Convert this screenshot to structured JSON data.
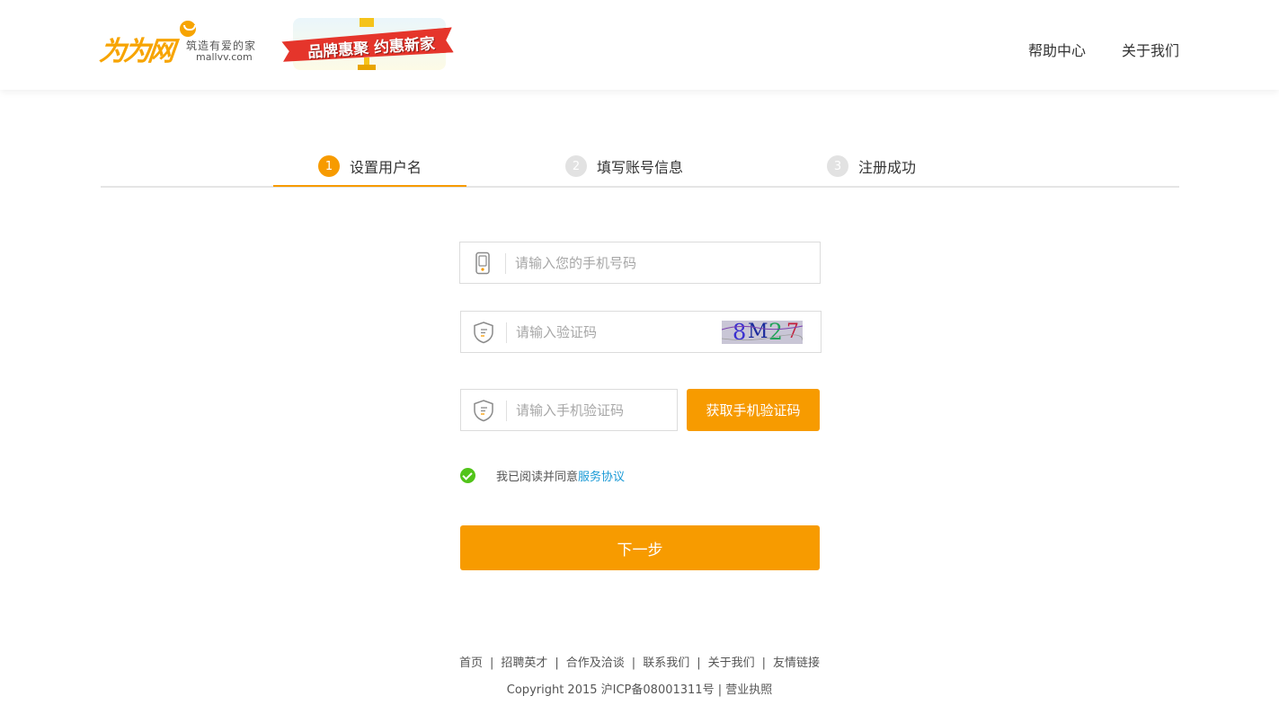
{
  "header": {
    "logo": {
      "mark": "为为网",
      "slogan": "筑造有爱的家",
      "domain": "mallvv.com"
    },
    "banner": {
      "text": "品牌惠聚 约惠新家"
    },
    "nav": {
      "help": "帮助中心",
      "about": "关于我们"
    }
  },
  "steps": [
    {
      "num": "1",
      "label": "设置用户名",
      "active": true
    },
    {
      "num": "2",
      "label": "填写账号信息",
      "active": false
    },
    {
      "num": "3",
      "label": "注册成功",
      "active": false
    }
  ],
  "form": {
    "phone": {
      "placeholder": "请输入您的手机号码",
      "value": ""
    },
    "captcha": {
      "placeholder": "请输入验证码",
      "value": "",
      "image_text": [
        "8",
        "M",
        "2",
        "7"
      ]
    },
    "sms_code": {
      "placeholder": "请输入手机验证码",
      "value": ""
    },
    "sms_button": "获取手机验证码",
    "agreement": {
      "text": "我已阅读并同意",
      "link": "服务协议",
      "checked": true
    },
    "next_button": "下一步"
  },
  "footer": {
    "links": [
      "首页",
      "招聘英才",
      "合作及洽谈",
      "联系我们",
      "关于我们",
      "友情链接"
    ],
    "copyright": "Copyright 2015 沪ICP备08001311号 | 营业执照"
  },
  "colors": {
    "accent": "#f79b00",
    "step_inactive": "#e2e2e2",
    "link": "#1a9ad6",
    "check": "#52c41a"
  }
}
